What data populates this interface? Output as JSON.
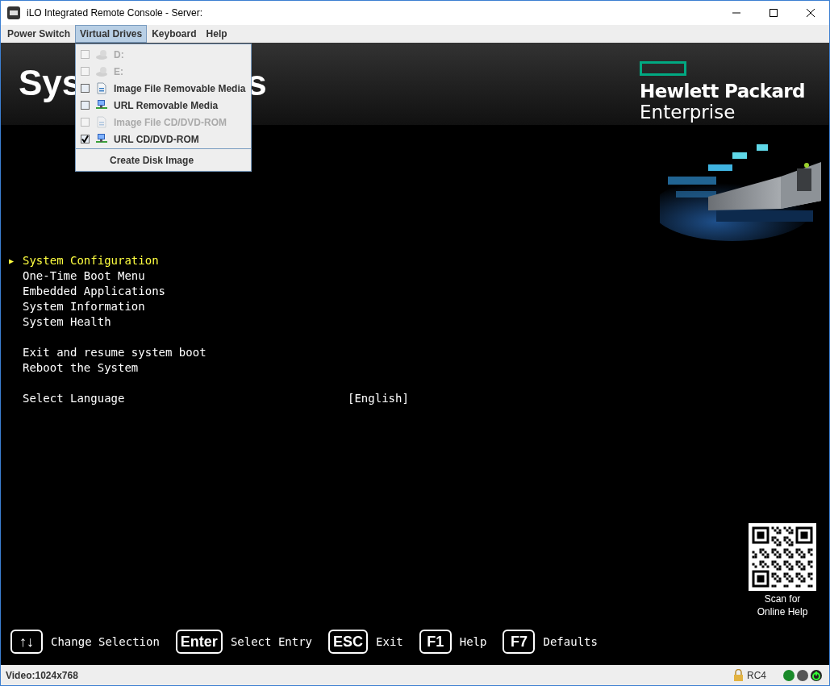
{
  "window": {
    "title": "iLO Integrated Remote Console - Server:"
  },
  "menu_bar": [
    {
      "label": "Power Switch",
      "selected": false
    },
    {
      "label": "Virtual Drives",
      "selected": true
    },
    {
      "label": "Keyboard",
      "selected": false
    },
    {
      "label": "Help",
      "selected": false
    }
  ],
  "dropdown": [
    {
      "kind": "drive",
      "label": "D:",
      "checked": false,
      "disabled": true
    },
    {
      "kind": "drive",
      "label": "E:",
      "checked": false,
      "disabled": true
    },
    {
      "kind": "image-file",
      "label": "Image File Removable Media",
      "checked": false,
      "disabled": false
    },
    {
      "kind": "url",
      "label": "URL Removable Media",
      "checked": false,
      "disabled": false
    },
    {
      "kind": "image-file",
      "label": "Image File CD/DVD-ROM",
      "checked": false,
      "disabled": true
    },
    {
      "kind": "url",
      "label": "URL CD/DVD-ROM",
      "checked": true,
      "disabled": false
    },
    {
      "kind": "action",
      "label": "Create Disk Image"
    }
  ],
  "console": {
    "title_parts": [
      "Sys",
      "s"
    ],
    "brand": {
      "line1": "Hewlett Packard",
      "line2": "Enterprise"
    },
    "menu_groups": [
      [
        {
          "label": "System Configuration",
          "selected": true
        },
        {
          "label": "One-Time Boot Menu",
          "selected": false
        },
        {
          "label": "Embedded Applications",
          "selected": false
        },
        {
          "label": "System Information",
          "selected": false
        },
        {
          "label": "System Health",
          "selected": false
        }
      ],
      [
        {
          "label": "Exit and resume system boot",
          "selected": false
        },
        {
          "label": "Reboot the System",
          "selected": false
        }
      ],
      [
        {
          "label": "Select Language",
          "value": "[English]",
          "selected": false
        }
      ]
    ],
    "selection_marker": "▶",
    "qr_caption": [
      "Scan for",
      "Online Help"
    ],
    "key_hints": [
      {
        "key": "↑↓",
        "label": "Change Selection"
      },
      {
        "key": "Enter",
        "label": "Select Entry"
      },
      {
        "key": "ESC",
        "label": "Exit"
      },
      {
        "key": "F1",
        "label": "Help"
      },
      {
        "key": "F7",
        "label": "Defaults"
      }
    ]
  },
  "status_bar": {
    "video": "Video:1024x768",
    "encryption": "RC4"
  }
}
